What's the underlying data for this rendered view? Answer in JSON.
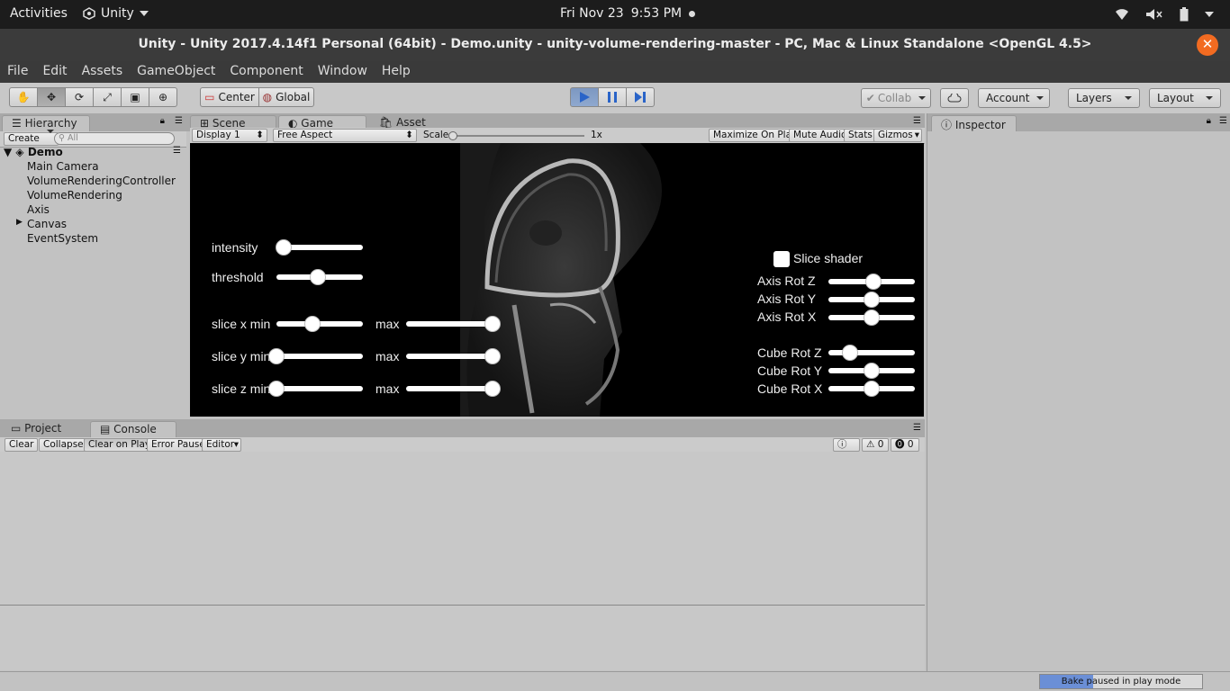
{
  "topbar": {
    "activities": "Activities",
    "app": "Unity",
    "clock_day": "Fri Nov 23",
    "clock_time": "9:53 PM"
  },
  "window": {
    "title": "Unity - Unity 2017.4.14f1 Personal (64bit) - Demo.unity - unity-volume-rendering-master - PC, Mac & Linux Standalone <OpenGL 4.5>"
  },
  "menu": [
    "File",
    "Edit",
    "Assets",
    "GameObject",
    "Component",
    "Window",
    "Help"
  ],
  "toolbar": {
    "center": "Center",
    "global": "Global",
    "collab": "Collab",
    "account": "Account",
    "layers": "Layers",
    "layout": "Layout"
  },
  "hierarchy": {
    "tab": "Hierarchy",
    "create": "Create",
    "search_placeholder": "All",
    "scene": "Demo",
    "items": [
      "Main Camera",
      "VolumeRenderingController",
      "VolumeRendering",
      "Axis",
      "Canvas",
      "EventSystem"
    ]
  },
  "center_tabs": {
    "scene": "Scene",
    "game": "Game",
    "asset_store": "Asset Store"
  },
  "game_bar": {
    "display": "Display 1",
    "aspect": "Free Aspect",
    "scale_label": "Scale",
    "scale_value": "1x",
    "maximize": "Maximize On Play",
    "mute": "Mute Audio",
    "stats": "Stats",
    "gizmos": "Gizmos"
  },
  "game_ui": {
    "intensity": {
      "label": "intensity",
      "value": 0.08
    },
    "threshold": {
      "label": "threshold",
      "value": 0.48
    },
    "slice_x": {
      "min_label": "slice x min",
      "max_label": "max",
      "min": 0.42,
      "max": 1.0
    },
    "slice_y": {
      "min_label": "slice y min",
      "max_label": "max",
      "min": 0.0,
      "max": 1.0
    },
    "slice_z": {
      "min_label": "slice z min",
      "max_label": "max",
      "min": 0.0,
      "max": 1.0
    },
    "slice_shader": "Slice shader",
    "axis_rot_z": {
      "label": "Axis Rot Z",
      "value": 0.52
    },
    "axis_rot_y": {
      "label": "Axis Rot Y",
      "value": 0.5
    },
    "axis_rot_x": {
      "label": "Axis Rot X",
      "value": 0.5
    },
    "cube_rot_z": {
      "label": "Cube Rot Z",
      "value": 0.25
    },
    "cube_rot_y": {
      "label": "Cube Rot Y",
      "value": 0.5
    },
    "cube_rot_x": {
      "label": "Cube Rot X",
      "value": 0.5
    }
  },
  "bottom_tabs": {
    "project": "Project",
    "console": "Console"
  },
  "console_bar": {
    "clear": "Clear",
    "collapse": "Collapse",
    "clear_on_play": "Clear on Play",
    "error_pause": "Error Pause",
    "editor": "Editor",
    "info_count": "0",
    "warn_count": "0",
    "error_count": "0"
  },
  "inspector": {
    "tab": "Inspector"
  },
  "status": {
    "bake": "Bake paused in play mode",
    "bake_progress": 0.33
  }
}
